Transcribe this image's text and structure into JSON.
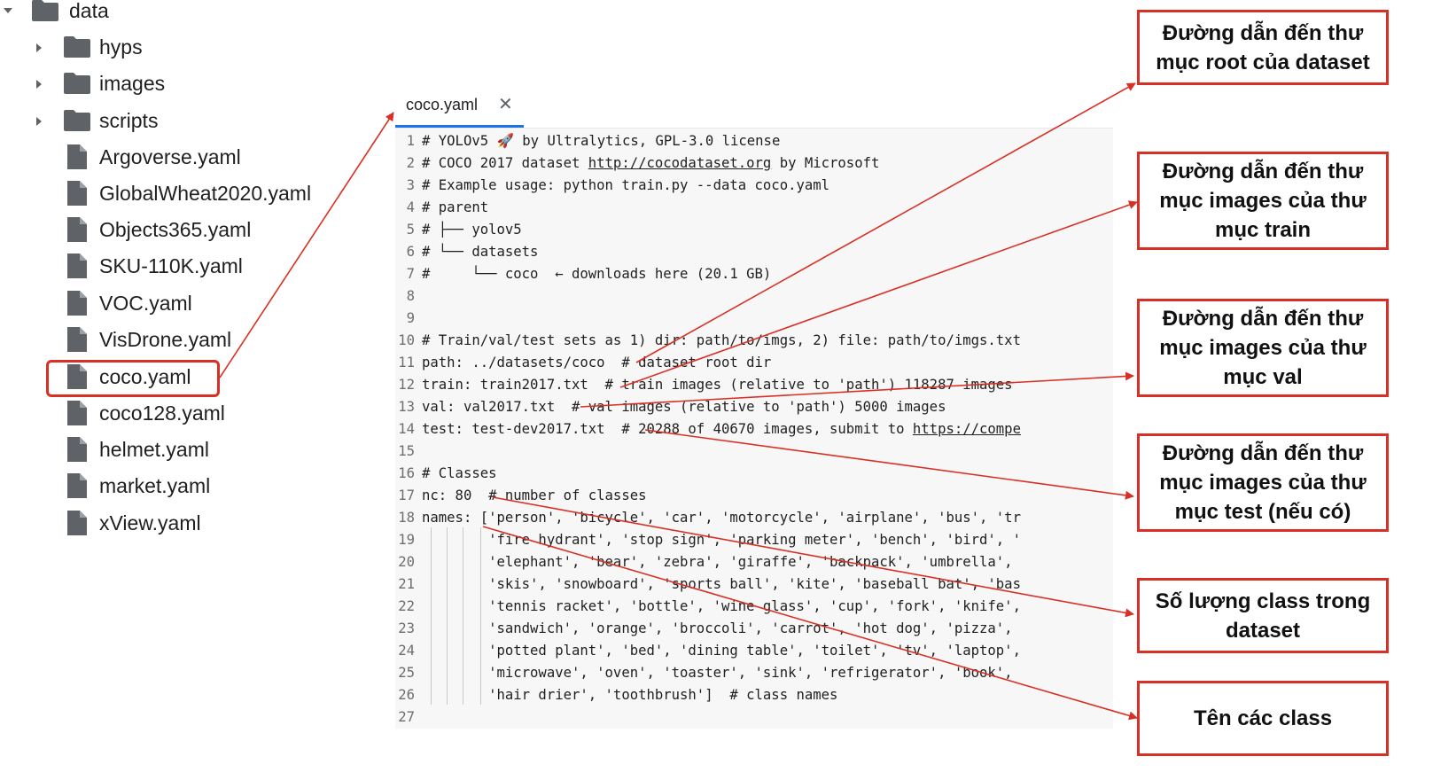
{
  "tree": {
    "root": {
      "label": "data",
      "icon": "folder-icon",
      "expanded": true
    },
    "folders": [
      {
        "label": "hyps",
        "icon": "folder-icon"
      },
      {
        "label": "images",
        "icon": "folder-icon"
      },
      {
        "label": "scripts",
        "icon": "folder-icon"
      }
    ],
    "files": [
      {
        "label": "Argoverse.yaml",
        "icon": "file-icon"
      },
      {
        "label": "GlobalWheat2020.yaml",
        "icon": "file-icon"
      },
      {
        "label": "Objects365.yaml",
        "icon": "file-icon"
      },
      {
        "label": "SKU-110K.yaml",
        "icon": "file-icon"
      },
      {
        "label": "VOC.yaml",
        "icon": "file-icon"
      },
      {
        "label": "VisDrone.yaml",
        "icon": "file-icon"
      },
      {
        "label": "coco.yaml",
        "icon": "file-icon",
        "selected": true
      },
      {
        "label": "coco128.yaml",
        "icon": "file-icon"
      },
      {
        "label": "helmet.yaml",
        "icon": "file-icon"
      },
      {
        "label": "market.yaml",
        "icon": "file-icon"
      },
      {
        "label": "xView.yaml",
        "icon": "file-icon"
      }
    ]
  },
  "editor": {
    "tab_label": "coco.yaml",
    "tab_close": "✕",
    "lines": [
      {
        "n": "1",
        "text": "# YOLOv5 🚀 by Ultralytics, GPL-3.0 license"
      },
      {
        "n": "2",
        "text": "# COCO 2017 dataset http://cocodataset.org by Microsoft"
      },
      {
        "n": "3",
        "text": "# Example usage: python train.py --data coco.yaml"
      },
      {
        "n": "4",
        "text": "# parent"
      },
      {
        "n": "5",
        "text": "# ├── yolov5"
      },
      {
        "n": "6",
        "text": "# └── datasets"
      },
      {
        "n": "7",
        "text": "#     └── coco  ← downloads here (20.1 GB)"
      },
      {
        "n": "8",
        "text": ""
      },
      {
        "n": "9",
        "text": ""
      },
      {
        "n": "10",
        "text": "# Train/val/test sets as 1) dir: path/to/imgs, 2) file: path/to/imgs.txt"
      },
      {
        "n": "11",
        "text": "path: ../datasets/coco  # dataset root dir"
      },
      {
        "n": "12",
        "text": "train: train2017.txt  # train images (relative to 'path') 118287 images"
      },
      {
        "n": "13",
        "text": "val: val2017.txt  # val images (relative to 'path') 5000 images"
      },
      {
        "n": "14",
        "text": "test: test-dev2017.txt  # 20288 of 40670 images, submit to https://compe"
      },
      {
        "n": "15",
        "text": ""
      },
      {
        "n": "16",
        "text": "# Classes"
      },
      {
        "n": "17",
        "text": "nc: 80  # number of classes"
      },
      {
        "n": "18",
        "text": "names: ['person', 'bicycle', 'car', 'motorcycle', 'airplane', 'bus', 'tr"
      },
      {
        "n": "19",
        "text": "        'fire hydrant', 'stop sign', 'parking meter', 'bench', 'bird', '"
      },
      {
        "n": "20",
        "text": "        'elephant', 'bear', 'zebra', 'giraffe', 'backpack', 'umbrella',"
      },
      {
        "n": "21",
        "text": "        'skis', 'snowboard', 'sports ball', 'kite', 'baseball bat', 'bas"
      },
      {
        "n": "22",
        "text": "        'tennis racket', 'bottle', 'wine glass', 'cup', 'fork', 'knife',"
      },
      {
        "n": "23",
        "text": "        'sandwich', 'orange', 'broccoli', 'carrot', 'hot dog', 'pizza',"
      },
      {
        "n": "24",
        "text": "        'potted plant', 'bed', 'dining table', 'toilet', 'tv', 'laptop',"
      },
      {
        "n": "25",
        "text": "        'microwave', 'oven', 'toaster', 'sink', 'refrigerator', 'book',"
      },
      {
        "n": "26",
        "text": "        'hair drier', 'toothbrush']  # class names"
      },
      {
        "n": "27",
        "text": ""
      }
    ]
  },
  "annotations": [
    {
      "text": "Đường dẫn đến thư mục root của dataset"
    },
    {
      "text": "Đường dẫn đến thư mục images của thư mục train"
    },
    {
      "text": "Đường dẫn đến thư mục images của thư mục val"
    },
    {
      "text": "Đường dẫn đến thư mục images của thư mục test (nếu có)"
    },
    {
      "text": "Số lượng class trong dataset"
    },
    {
      "text": "Tên các class"
    }
  ],
  "colors": {
    "accent": "#1a73e8",
    "annotation": "#d93025",
    "icon": "#5f6368",
    "editor_bg": "#f7f7f7"
  }
}
